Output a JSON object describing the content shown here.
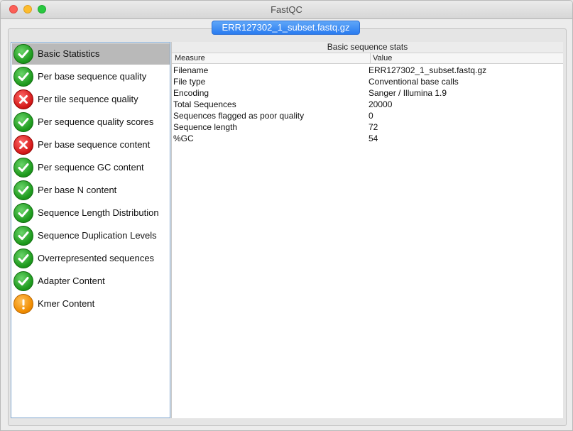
{
  "window": {
    "title": "FastQC"
  },
  "file_tab": {
    "label": "ERR127302_1_subset.fastq.gz"
  },
  "sidebar": {
    "items": [
      {
        "label": "Basic Statistics",
        "status": "pass",
        "icon": "check-icon",
        "selected": true
      },
      {
        "label": "Per base sequence quality",
        "status": "pass",
        "icon": "check-icon"
      },
      {
        "label": "Per tile sequence quality",
        "status": "fail",
        "icon": "cross-icon"
      },
      {
        "label": "Per sequence quality scores",
        "status": "pass",
        "icon": "check-icon"
      },
      {
        "label": "Per base sequence content",
        "status": "fail",
        "icon": "cross-icon"
      },
      {
        "label": "Per sequence GC content",
        "status": "pass",
        "icon": "check-icon"
      },
      {
        "label": "Per base N content",
        "status": "pass",
        "icon": "check-icon"
      },
      {
        "label": "Sequence Length Distribution",
        "status": "pass",
        "icon": "check-icon"
      },
      {
        "label": "Sequence Duplication Levels",
        "status": "pass",
        "icon": "check-icon"
      },
      {
        "label": "Overrepresented sequences",
        "status": "pass",
        "icon": "check-icon"
      },
      {
        "label": "Adapter Content",
        "status": "pass",
        "icon": "check-icon"
      },
      {
        "label": "Kmer Content",
        "status": "warn",
        "icon": "warning-icon"
      }
    ]
  },
  "panel": {
    "title": "Basic sequence stats",
    "columns": [
      "Measure",
      "Value"
    ],
    "rows": [
      [
        "Filename",
        "ERR127302_1_subset.fastq.gz"
      ],
      [
        "File type",
        "Conventional base calls"
      ],
      [
        "Encoding",
        "Sanger / Illumina 1.9"
      ],
      [
        "Total Sequences",
        "20000"
      ],
      [
        "Sequences flagged as poor quality",
        "0"
      ],
      [
        "Sequence length",
        "72"
      ],
      [
        "%GC",
        "54"
      ]
    ]
  },
  "colors": {
    "pass": "#1e9a1e",
    "fail": "#d41a1a",
    "warn": "#f08c00",
    "tab_accent": "#2a7cf0",
    "selection": "#b9b9b9"
  }
}
